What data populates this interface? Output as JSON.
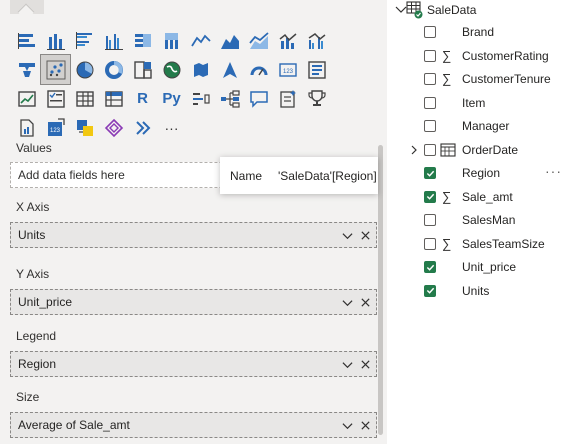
{
  "viz_pane": {
    "more_label": "···",
    "wells": {
      "values": {
        "title": "Values",
        "placeholder": "Add data fields here"
      },
      "x_axis": {
        "title": "X Axis",
        "value": "Units"
      },
      "y_axis": {
        "title": "Y Axis",
        "value": "Unit_price"
      },
      "legend": {
        "title": "Legend",
        "value": "Region"
      },
      "size": {
        "title": "Size",
        "value": "Average of Sale_amt"
      }
    },
    "text_icons": {
      "r": "R",
      "python": "Py"
    }
  },
  "tooltip": {
    "key": "Name",
    "value": "'SaleData'[Region]"
  },
  "fields_pane": {
    "table_name": "SaleData",
    "fields": [
      {
        "label": "Brand",
        "checked": false,
        "sigma": false
      },
      {
        "label": "CustomerRating",
        "checked": false,
        "sigma": true
      },
      {
        "label": "CustomerTenure",
        "checked": false,
        "sigma": true
      },
      {
        "label": "Item",
        "checked": false,
        "sigma": false
      },
      {
        "label": "Manager",
        "checked": false,
        "sigma": false
      },
      {
        "label": "OrderDate",
        "checked": false,
        "sigma": false,
        "calendar": true,
        "expandable": true
      },
      {
        "label": "Region",
        "checked": true,
        "sigma": false,
        "more": "···"
      },
      {
        "label": "Sale_amt",
        "checked": true,
        "sigma": true
      },
      {
        "label": "SalesMan",
        "checked": false,
        "sigma": false
      },
      {
        "label": "SalesTeamSize",
        "checked": false,
        "sigma": true
      },
      {
        "label": "Unit_price",
        "checked": true,
        "sigma": false
      },
      {
        "label": "Units",
        "checked": true,
        "sigma": false
      }
    ]
  },
  "colors": {
    "check_green": "#237b4b",
    "accent_blue": "#2b6ab5",
    "pane_bg": "#f3f2f1"
  }
}
